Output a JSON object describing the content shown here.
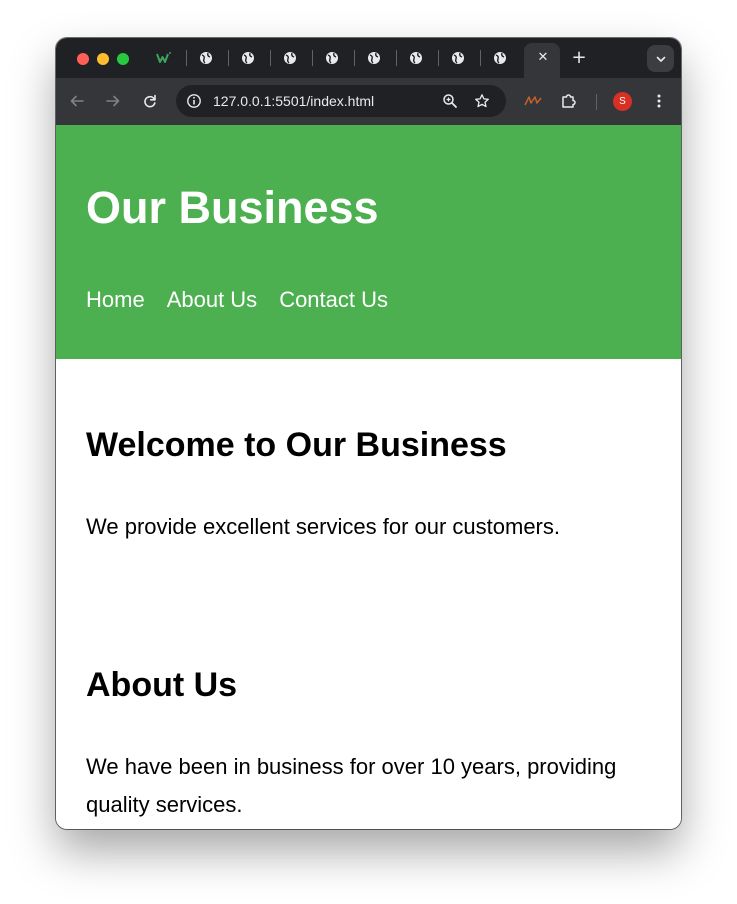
{
  "browser": {
    "tabs": [
      {
        "icon": "w-favicon"
      },
      {
        "icon": "globe-icon"
      },
      {
        "icon": "globe-icon"
      },
      {
        "icon": "globe-icon"
      },
      {
        "icon": "globe-icon"
      },
      {
        "icon": "globe-icon"
      },
      {
        "icon": "globe-icon"
      },
      {
        "icon": "globe-icon"
      },
      {
        "icon": "globe-icon"
      }
    ],
    "active_tab_close": "✕",
    "new_tab_label": "+",
    "url": "127.0.0.1:5501/index.html",
    "profile_initial": "S",
    "colors": {
      "tab_strip": "#202124",
      "toolbar": "#35363a",
      "omnibox": "#202124",
      "profile": "#d93025"
    }
  },
  "page": {
    "header": {
      "title": "Our Business",
      "background": "#4caf50",
      "nav": [
        {
          "label": "Home"
        },
        {
          "label": "About Us"
        },
        {
          "label": "Contact Us"
        }
      ]
    },
    "sections": [
      {
        "heading": "Welcome to Our Business",
        "text": "We provide excellent services for our customers."
      },
      {
        "heading": "About Us",
        "text": "We have been in business for over 10 years, providing quality services."
      }
    ]
  }
}
